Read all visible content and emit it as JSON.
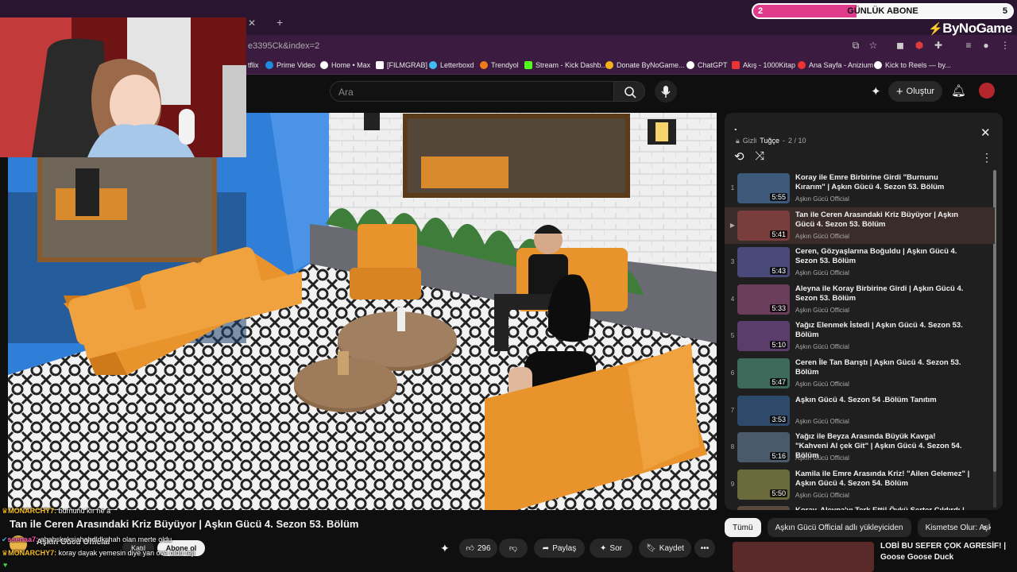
{
  "browser": {
    "url": "e3395Ck&index=2",
    "bookmarks": [
      {
        "label": "tflix"
      },
      {
        "label": "Prime Video"
      },
      {
        "label": "Home • Max"
      },
      {
        "label": "[FILMGRAB]"
      },
      {
        "label": "Letterboxd"
      },
      {
        "label": "Trendyol"
      },
      {
        "label": "Stream - Kick Dashb..."
      },
      {
        "label": "Donate ByNoGame..."
      },
      {
        "label": "ChatGPT"
      },
      {
        "label": "Akış - 1000Kitap"
      },
      {
        "label": "Ana Sayfa - Anizium"
      },
      {
        "label": "Kick to Reels — by..."
      }
    ]
  },
  "overlay": {
    "goal_label": "GÜNLÜK ABONE",
    "goal_current": "2",
    "goal_target": "5",
    "goal_fraction": 0.4,
    "brand": "ByNoGame"
  },
  "header": {
    "search_placeholder": "Ara",
    "create_label": "Oluştur"
  },
  "playlist": {
    "title": ".",
    "privacy": "Gizli",
    "owner": "Tuğçe",
    "position": "2 / 10",
    "items": [
      {
        "index": "1",
        "title": "Koray ile Emre Birbirine Girdi \"Burnunu Kırarım\" | Aşkın Gücü 4. Sezon 53. Bölüm",
        "channel": "Aşkın Gücü Official",
        "duration": "5:55"
      },
      {
        "index": "▶",
        "title": "Tan ile Ceren Arasındaki Kriz Büyüyor | Aşkın Gücü 4. Sezon 53. Bölüm",
        "channel": "Aşkın Gücü Official",
        "duration": "5:41"
      },
      {
        "index": "3",
        "title": "Ceren, Gözyaşlarına Boğuldu | Aşkın Gücü 4. Sezon 53. Bölüm",
        "channel": "Aşkın Gücü Official",
        "duration": "5:43"
      },
      {
        "index": "4",
        "title": "Aleyna ile Koray Birbirine Girdi | Aşkın Gücü 4. Sezon 53. Bölüm",
        "channel": "Aşkın Gücü Official",
        "duration": "5:33"
      },
      {
        "index": "5",
        "title": "Yağız Elenmek İstedi | Aşkın Gücü 4. Sezon 53. Bölüm",
        "channel": "Aşkın Gücü Official",
        "duration": "5:10"
      },
      {
        "index": "6",
        "title": "Ceren İle Tan Barıştı | Aşkın Gücü 4. Sezon 53. Bölüm",
        "channel": "Aşkın Gücü Official",
        "duration": "5:47"
      },
      {
        "index": "7",
        "title": "Aşkın Gücü 4. Sezon 54 .Bölüm Tanıtım",
        "channel": "Aşkın Gücü Official",
        "duration": "3:53"
      },
      {
        "index": "8",
        "title": "Yağız ile Beyza Arasında Büyük Kavga! \"Kahveni Al çek Git\" | Aşkın Gücü 4. Sezon 54. Bölüm",
        "channel": "Aşkın Gücü Official",
        "duration": "5:16"
      },
      {
        "index": "9",
        "title": "Kamila ile Emre Arasında Kriz! \"Ailen Gelemez\" | Aşkın Gücü 4. Sezon 54. Bölüm",
        "channel": "Aşkın Gücü Official",
        "duration": "5:50"
      },
      {
        "index": "",
        "title": "Koray, Aleyna'yı Terk Etti! Öykü Serter Çıldırdı |",
        "channel": "",
        "duration": ""
      }
    ]
  },
  "chips": [
    "Tümü",
    "Aşkın Gücü Official adlı yükleyiciden",
    "Kismetse Olur: Aşkın"
  ],
  "video": {
    "title": "Tan ile Ceren Arasındaki Kriz Büyüyor | Aşkın Gücü 4. Sezon 53. Bölüm",
    "channel": "Aşkın Gücü Official",
    "join_label": "Katıl",
    "subscribe_label": "Abone ol",
    "likes": "296",
    "share_label": "Paylaş",
    "ask_label": "Sor",
    "save_label": "Kaydet"
  },
  "rec": {
    "title": "LOBİ BU SEFER ÇOK AGRESİF! |",
    "subtitle": "Goose Goose Duck"
  },
  "chat": [
    {
      "user": "MONARCHY7:",
      "text": "burnunu kır ne a"
    },
    {
      "user": "ssenaa7:",
      "text": "ahahskaksjahahdldkshah olan merte oldu"
    },
    {
      "user": "MONARCHY7:",
      "text": "koray dayak yemesin diye yan ove oldu reji"
    }
  ],
  "colors": {
    "accent": "#e03a8a",
    "bg": "#0f0f0f",
    "panel": "#1f1f1f",
    "sofa": "#e8932c"
  }
}
